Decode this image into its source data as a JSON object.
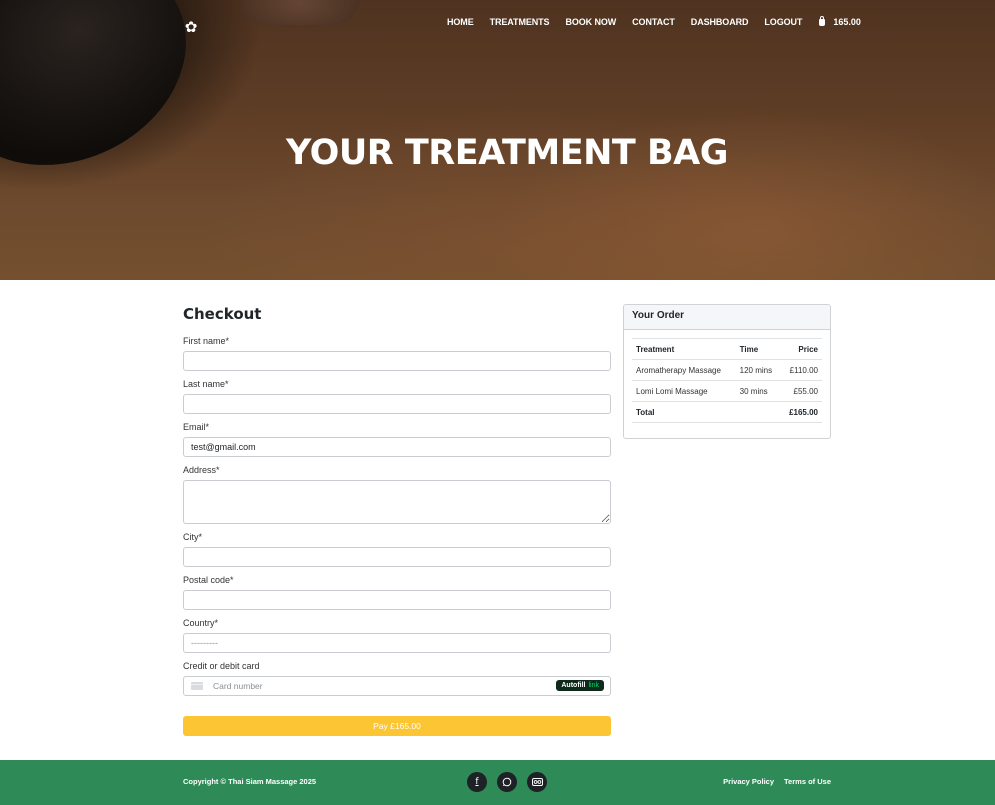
{
  "nav": {
    "items": [
      "HOME",
      "TREATMENTS",
      "BOOK NOW",
      "CONTACT",
      "DASHBOARD",
      "LOGOUT"
    ],
    "cart_total": "165.00",
    "logo_icon": "lotus-flower-icon",
    "cart_icon": "shopping-bag-icon"
  },
  "hero": {
    "title": "YOUR TREATMENT BAG"
  },
  "checkout": {
    "heading": "Checkout",
    "fields": {
      "first_name": {
        "label": "First name*",
        "value": ""
      },
      "last_name": {
        "label": "Last name*",
        "value": ""
      },
      "email": {
        "label": "Email*",
        "value": "test@gmail.com"
      },
      "address": {
        "label": "Address*",
        "value": ""
      },
      "city": {
        "label": "City*",
        "value": ""
      },
      "postal_code": {
        "label": "Postal code*",
        "value": ""
      },
      "country": {
        "label": "Country*",
        "value": "",
        "placeholder": "---------"
      }
    },
    "card": {
      "label": "Credit or debit card",
      "placeholder": "Card number",
      "autofill_label": "Autofill",
      "autofill_brand": "link"
    },
    "pay_button": "Pay £165.00"
  },
  "order": {
    "title": "Your Order",
    "columns": [
      "Treatment",
      "Time",
      "Price"
    ],
    "rows": [
      {
        "treatment": "Aromatherapy Massage",
        "time": "120 mins",
        "price": "£110.00"
      },
      {
        "treatment": "Lomi Lomi Massage",
        "time": "30 mins",
        "price": "£55.00"
      }
    ],
    "total_label": "Total",
    "total_value": "£165.00"
  },
  "footer": {
    "copyright": "Copyright © Thai Siam Massage 2025",
    "socials": [
      "facebook-icon",
      "whatsapp-icon",
      "tripadvisor-icon"
    ],
    "links": [
      "Privacy Policy",
      "Terms of Use"
    ]
  },
  "colors": {
    "footer_bg": "#2e8b57",
    "pay_button": "#fbc534",
    "hero_tint": "#5e3d25"
  }
}
